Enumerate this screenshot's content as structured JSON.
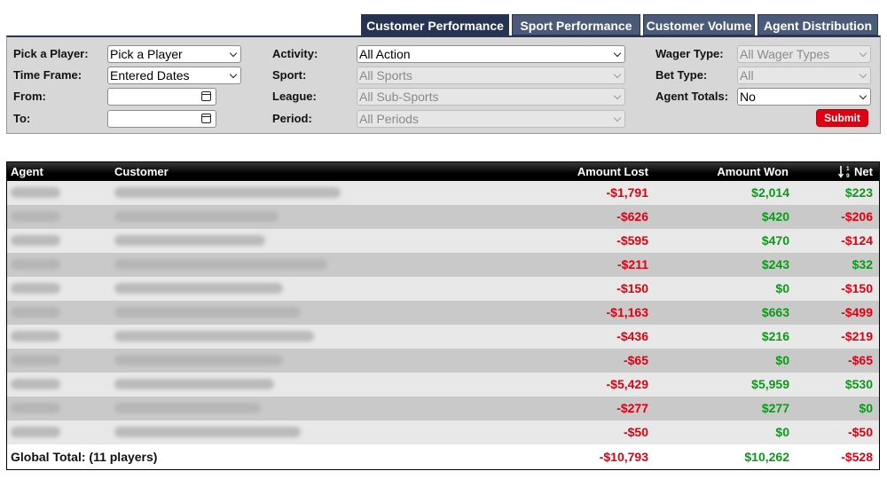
{
  "tabs": [
    {
      "label": "Customer Performance",
      "active": true
    },
    {
      "label": "Sport Performance",
      "active": false
    },
    {
      "label": "Customer Volume",
      "active": false
    },
    {
      "label": "Agent Distribution",
      "active": false
    }
  ],
  "filters": {
    "player": {
      "label": "Pick a Player:",
      "value": "Pick a Player"
    },
    "time_frame": {
      "label": "Time Frame:",
      "value": "Entered Dates"
    },
    "from": {
      "label": "From:",
      "value": ""
    },
    "to": {
      "label": "To:",
      "value": ""
    },
    "activity": {
      "label": "Activity:",
      "value": "All Action"
    },
    "sport": {
      "label": "Sport:",
      "value": "All Sports"
    },
    "league": {
      "label": "League:",
      "value": "All Sub-Sports"
    },
    "period": {
      "label": "Period:",
      "value": "All Periods"
    },
    "wager_type": {
      "label": "Wager Type:",
      "value": "All Wager Types"
    },
    "bet_type": {
      "label": "Bet Type:",
      "value": "All"
    },
    "agent_totals": {
      "label": "Agent Totals:",
      "value": "No"
    },
    "submit_label": "Submit"
  },
  "table": {
    "headers": {
      "agent": "Agent",
      "customer": "Customer",
      "amount_lost": "Amount Lost",
      "amount_won": "Amount Won",
      "net": "Net"
    },
    "rows": [
      {
        "lost": "-$1,791",
        "won": "$2,014",
        "net": "$223",
        "net_color": "green",
        "won_color": "green"
      },
      {
        "lost": "-$626",
        "won": "$420",
        "net": "-$206",
        "net_color": "red",
        "won_color": "green"
      },
      {
        "lost": "-$595",
        "won": "$470",
        "net": "-$124",
        "net_color": "red",
        "won_color": "green"
      },
      {
        "lost": "-$211",
        "won": "$243",
        "net": "$32",
        "net_color": "green",
        "won_color": "green"
      },
      {
        "lost": "-$150",
        "won": "$0",
        "net": "-$150",
        "net_color": "red",
        "won_color": "green"
      },
      {
        "lost": "-$1,163",
        "won": "$663",
        "net": "-$499",
        "net_color": "red",
        "won_color": "green"
      },
      {
        "lost": "-$436",
        "won": "$216",
        "net": "-$219",
        "net_color": "red",
        "won_color": "green"
      },
      {
        "lost": "-$65",
        "won": "$0",
        "net": "-$65",
        "net_color": "red",
        "won_color": "green"
      },
      {
        "lost": "-$5,429",
        "won": "$5,959",
        "net": "$530",
        "net_color": "green",
        "won_color": "green"
      },
      {
        "lost": "-$277",
        "won": "$277",
        "net": "$0",
        "net_color": "green",
        "won_color": "green"
      },
      {
        "lost": "-$50",
        "won": "$0",
        "net": "-$50",
        "net_color": "red",
        "won_color": "green"
      }
    ],
    "total": {
      "label": "Global Total: (11 players)",
      "lost": "-$10,793",
      "won": "$10,262",
      "net": "-$528"
    }
  },
  "colors": {
    "loss": "#e00010",
    "gain": "#0a9a1a",
    "tab": "#4b5a78",
    "submit": "#e00012"
  }
}
